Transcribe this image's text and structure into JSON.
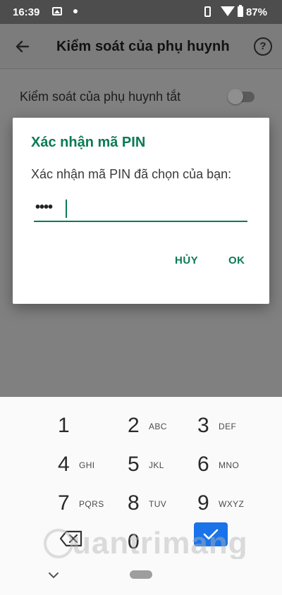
{
  "status_bar": {
    "time": "16:39",
    "battery": "87%"
  },
  "app_bar": {
    "title": "Kiểm soát của phụ huynh",
    "help_symbol": "?"
  },
  "setting": {
    "label": "Kiểm soát của phụ huynh tắt",
    "enabled": false
  },
  "dialog": {
    "title": "Xác nhận mã PIN",
    "message": "Xác nhận mã PIN đã chọn của bạn:",
    "pin_masked": "••••",
    "cancel_label": "HỦY",
    "ok_label": "OK"
  },
  "keyboard": {
    "keys": [
      {
        "digit": "1",
        "letters": ""
      },
      {
        "digit": "2",
        "letters": "ABC"
      },
      {
        "digit": "3",
        "letters": "DEF"
      },
      {
        "digit": "4",
        "letters": "GHI"
      },
      {
        "digit": "5",
        "letters": "JKL"
      },
      {
        "digit": "6",
        "letters": "MNO"
      },
      {
        "digit": "7",
        "letters": "PQRS"
      },
      {
        "digit": "8",
        "letters": "TUV"
      },
      {
        "digit": "9",
        "letters": "WXYZ"
      },
      {
        "digit": "0",
        "letters": ""
      }
    ]
  },
  "watermark": {
    "text": "uantrimang"
  },
  "colors": {
    "accent": "#0a7a55",
    "done_key": "#1a73e8"
  }
}
